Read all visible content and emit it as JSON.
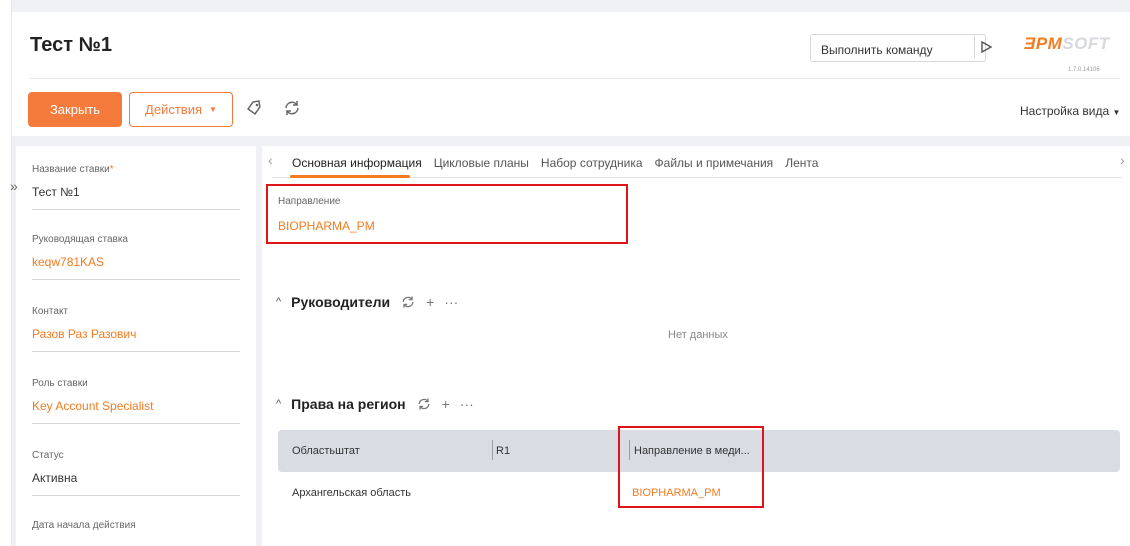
{
  "header": {
    "title": "Тест №1",
    "command_input_placeholder": "Выполнить команду",
    "logo_part1": "ƎPM",
    "logo_part2": "SOFT",
    "version": "1.7.0.14106"
  },
  "toolbar": {
    "close_label": "Закрыть",
    "actions_label": "Действия",
    "view_settings_label": "Настройка вида"
  },
  "icons": {
    "run": "play-triangle-icon",
    "tag": "tag-icon",
    "refresh": "refresh-icon",
    "expand": "double-chevron-right-icon"
  },
  "left_panel": {
    "fields": [
      {
        "label": "Название ставки",
        "required_mark": "*",
        "value": "Тест №1"
      },
      {
        "label": "Руководящая ставка",
        "value": "keqw781KAS"
      },
      {
        "label": "Контакт",
        "value": "Разов Раз Разович"
      },
      {
        "label": "Роль ставки",
        "value": "Key Account Specialist"
      },
      {
        "label": "Статус",
        "value": "Активна"
      },
      {
        "label": "Дата начала действия"
      }
    ]
  },
  "tabs": [
    {
      "label": "Основная информация",
      "active": true
    },
    {
      "label": "Цикловые планы"
    },
    {
      "label": "Набор сотрудника"
    },
    {
      "label": "Файлы и примечания"
    },
    {
      "label": "Лента"
    }
  ],
  "main": {
    "direction": {
      "label": "Направление",
      "value": "BIOPHARMA_PM"
    },
    "managers": {
      "title": "Руководители",
      "empty_text": "Нет данных"
    },
    "region_rights": {
      "title": "Права на регион",
      "columns": [
        "Областьштат",
        "R1",
        "Направление в меди..."
      ],
      "rows": [
        [
          "Архангельская область",
          "",
          "BIOPHARMA_PM"
        ]
      ]
    }
  },
  "colors": {
    "accent": "#f47b20",
    "highlight_box": "#e0121a"
  }
}
